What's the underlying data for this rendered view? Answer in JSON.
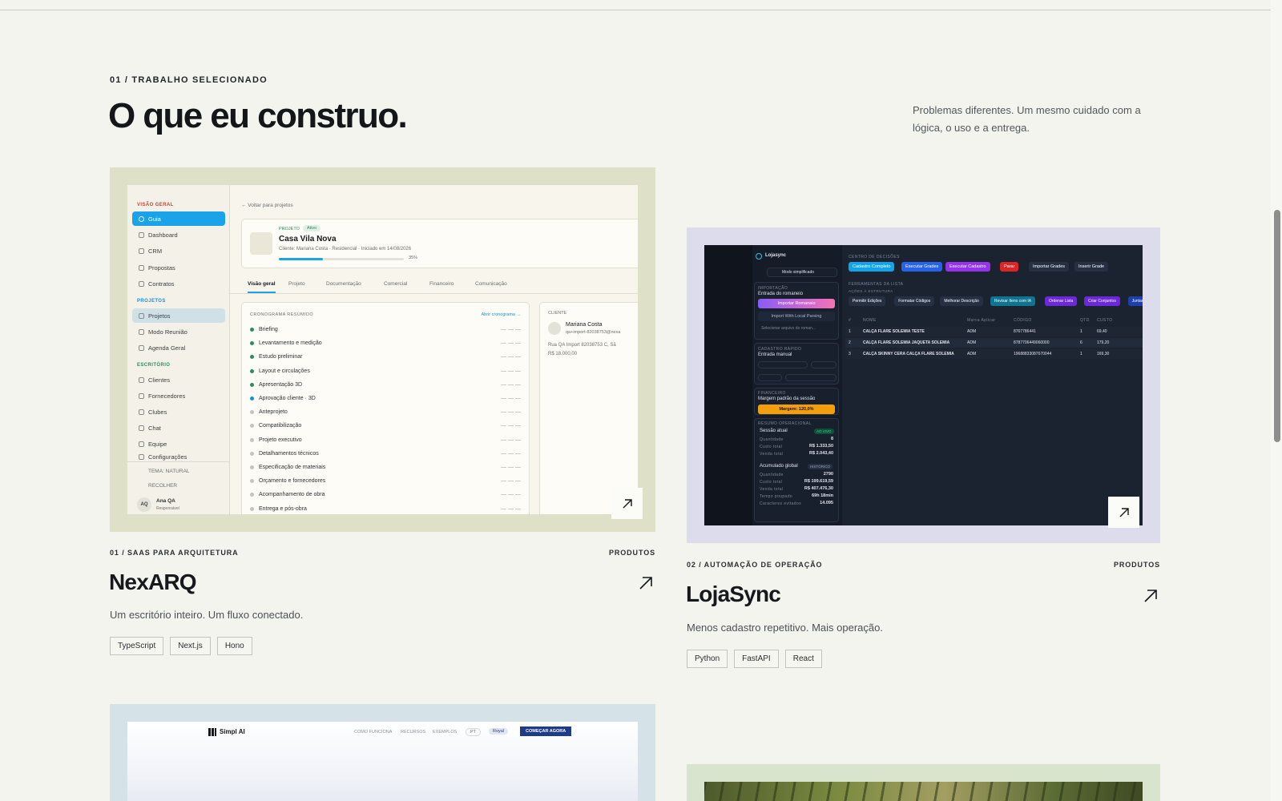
{
  "section": {
    "eyebrow": "01 / TRABALHO SELECIONADO",
    "headline": "O que eu construo.",
    "intro": "Problemas diferentes. Um mesmo cuidado com a lógica, o uso e a entrega."
  },
  "projects": [
    {
      "category": "01 / SAAS PARA ARQUITETURA",
      "kind": "PRODUTOS",
      "title": "NexARQ",
      "description": "Um escritório inteiro. Um fluxo conectado.",
      "tags": [
        "TypeScript",
        "Next.js",
        "Hono"
      ],
      "preview_bg": "#dfe0c8",
      "preview": {
        "sidebar_sections": [
          "VISÃO GERAL",
          "PROJETOS",
          "ESCRITÓRIO"
        ],
        "sidebar_items": [
          "Guia",
          "Dashboard",
          "CRM",
          "Propostas",
          "Contratos",
          "Projetos",
          "Modo Reunião",
          "Agenda Geral",
          "Clientes",
          "Fornecedores",
          "Clubes",
          "Chat",
          "Equipe",
          "Configurações"
        ],
        "theme": "TEMA: NATURAL",
        "collapse": "RECOLHER",
        "user_name": "Ana QA",
        "user_role": "Responsável",
        "user_initials": "AQ",
        "back": "← Voltar para projetos",
        "project_label": "PROJETO",
        "status": "Ativo",
        "project_name": "Casa Vila Nova",
        "client_line": "Cliente: Mariana Costa · Residencial · Iniciado em 14/08/2026",
        "progress_pct": 35,
        "progress_text": "35%",
        "tabs": [
          "Visão geral",
          "Projeto",
          "Documentação",
          "Comercial",
          "Financeiro",
          "Comunicação"
        ],
        "schedule_title": "CRONOGRAMA RESUMIDO",
        "schedule_link": "Abrir cronograma →",
        "schedule": [
          "Briefing",
          "Levantamento e medição",
          "Estudo preliminar",
          "Layout e circulações",
          "Apresentação 3D",
          "Aprovação cliente · 3D",
          "Anteprojeto",
          "Compatibilização",
          "Projeto executivo",
          "Detalhamentos técnicos",
          "Especificação de materiais",
          "Orçamento e fornecedores",
          "Acompanhamento de obra",
          "Entrega e pós-obra"
        ],
        "schedule_dash": "— — —",
        "client_title": "CLIENTE",
        "client_name": "Mariana Costa",
        "client_email": "qa+import-82038753@nexa",
        "client_address": "Rua QA Import 82038753 C, Sã",
        "client_value": "R$ 18.000,00"
      }
    },
    {
      "category": "02 / AUTOMAÇÃO DE OPERAÇÃO",
      "kind": "PRODUTOS",
      "title": "LojaSync",
      "description": "Menos cadastro repetitivo. Mais operação.",
      "tags": [
        "Python",
        "FastAPI",
        "React"
      ],
      "preview_bg": "#dcdcec",
      "preview": {
        "brand": "Lojasync",
        "mode": "Modo simplificado",
        "import_label": "IMPORTAÇÃO",
        "import_title": "Entrada do romaneio",
        "import_btn": "Importar Romaneio",
        "import_local": "Import With Local Parsing",
        "select_file": "Selecionar arquivo do roman...",
        "manual_label": "CADASTRO RÁPIDO",
        "manual_title": "Entrada manual",
        "fin_label": "FINANCEIRO",
        "fin_title": "Margem padrão da sessão",
        "margin_btn": "Margem: 120,0%",
        "session_label": "RESUMO OPERACIONAL",
        "session_title": "Sessão atual",
        "session_badge": "AO VIVO",
        "session_rows": [
          [
            "Quantidade",
            "8"
          ],
          [
            "Custo total",
            "R$ 1.333,50"
          ],
          [
            "Venda total",
            "R$ 2.043,40"
          ]
        ],
        "global_title": "Acumulado global",
        "global_badge": "HISTÓRICO",
        "global_rows": [
          [
            "Quantidade",
            "2790"
          ],
          [
            "Custo total",
            "R$ 199.619,59"
          ],
          [
            "Venda total",
            "R$ 407.476,30"
          ],
          [
            "Tempo poupado",
            "69h 18min"
          ],
          [
            "Caracteres evitados",
            "14.095"
          ]
        ],
        "center_label": "CENTRO DE DECISÕES",
        "actions": [
          "Cadastro Completo",
          "Executar Grades",
          "Executar Cadastro",
          "Parar",
          "Importar Grades",
          "Inserir Grade"
        ],
        "list_label": "FERRAMENTAS DA LISTA",
        "list_sub": "AÇÕES À ESTRUTURA",
        "tools": [
          "Permitir Edições",
          "Formatar Códigos",
          "Melhorar Descrição",
          "Revisar Itens com IA",
          "Ordenar Lista",
          "Criar Conjuntos",
          "Juntar I"
        ],
        "columns": [
          "#",
          "NOME",
          "Marca Aplicar",
          "CÓDIGO",
          "QTD",
          "CUSTO"
        ],
        "rows": [
          [
            "1",
            "CALÇA FLARE SOLEMIA TESTE",
            "ADM",
            "8767786441",
            "1",
            "69,40"
          ],
          [
            "2",
            "CALÇA FLARE SOLEMIA JAQUETA SOLEMIA",
            "ADM",
            "8787706449060000",
            "6",
            "179,20"
          ],
          [
            "3",
            "CALÇA SKINNY CERA CALÇA FLARE SOLEMIA",
            "ADM",
            "19688833087670044",
            "1",
            "169,30"
          ]
        ]
      }
    },
    {
      "preview_bg": "#d5e2e8",
      "preview": {
        "brand": "Simpl AI",
        "nav": [
          "COMO FUNCIONA",
          "RECURSOS",
          "EXEMPLOS"
        ],
        "lang": "PT",
        "plan": "Royal",
        "cta": "COMEÇAR AGORA"
      }
    },
    {
      "preview_bg": "#d9e4cf"
    }
  ],
  "colors": {
    "page_bg": "#f4f4ef",
    "accent_blue": "#1aa3e8",
    "ls_dark": "#1b2230"
  }
}
